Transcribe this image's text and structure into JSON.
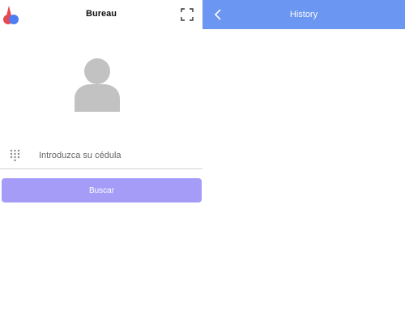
{
  "colors": {
    "header_blue": "#6b96f1",
    "button_purple": "#a59cf8",
    "avatar_gray": "#c2c2c2",
    "logo_red": "#e8484f",
    "logo_blue": "#4f7cf2"
  },
  "left": {
    "title": "Bureau",
    "logo_icon": "app-logo-icon",
    "expand_icon": "fullscreen-expand-icon",
    "avatar_icon": "user-avatar-icon",
    "input": {
      "icon": "keypad-icon",
      "placeholder": "Introduzca su cédula",
      "value": ""
    },
    "search_button_label": "Buscar"
  },
  "right": {
    "title": "History",
    "back_icon": "chevron-left-icon"
  }
}
